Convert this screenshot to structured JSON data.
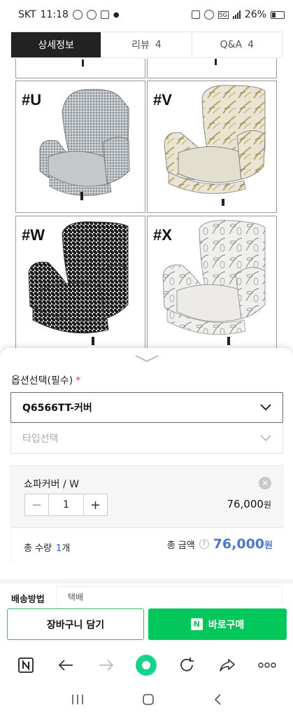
{
  "status_bar": {
    "carrier": "SKT",
    "time": "11:18",
    "network": "5G",
    "battery": "26%"
  },
  "tabs": [
    {
      "label": "상세정보",
      "count": "",
      "active": true
    },
    {
      "label": "리뷰",
      "count": "4",
      "active": false
    },
    {
      "label": "Q&A",
      "count": "4",
      "active": false
    }
  ],
  "gallery": {
    "items": [
      {
        "label": "#U",
        "pattern": "gray-check"
      },
      {
        "label": "#V",
        "pattern": "leaf-print"
      },
      {
        "label": "#W",
        "pattern": "houndstooth"
      },
      {
        "label": "#X",
        "pattern": "line-floral"
      }
    ]
  },
  "options": {
    "title": "옵션선택(필수)",
    "required_mark": "*",
    "select1_value": "Q6566TT-커버",
    "select2_placeholder": "타입선택"
  },
  "selected_item": {
    "name": "쇼파커버 / W",
    "quantity": "1",
    "price": "76,000",
    "price_unit": "원",
    "remove_icon": "close-icon"
  },
  "total": {
    "quantity_label": "총 수량",
    "quantity_value": "1",
    "quantity_unit": "개",
    "amount_label": "총 금액",
    "amount_help": "?",
    "amount_value": "76,000",
    "amount_unit": "원"
  },
  "shipping": {
    "label": "배송방법",
    "value": "택배"
  },
  "actions": {
    "cart_label": "장바구니 담기",
    "buy_label": "바로구매",
    "buy_badge": "N"
  },
  "browser_bar": {
    "icons": [
      "naver-n-icon",
      "back-arrow-icon",
      "forward-arrow-icon",
      "home-icon",
      "refresh-icon",
      "share-icon",
      "more-icon"
    ]
  },
  "colors": {
    "naver_green": "#03c75a",
    "required_red": "#e23b3b",
    "price_blue": "#4a79c9",
    "active_tab": "#222222"
  }
}
